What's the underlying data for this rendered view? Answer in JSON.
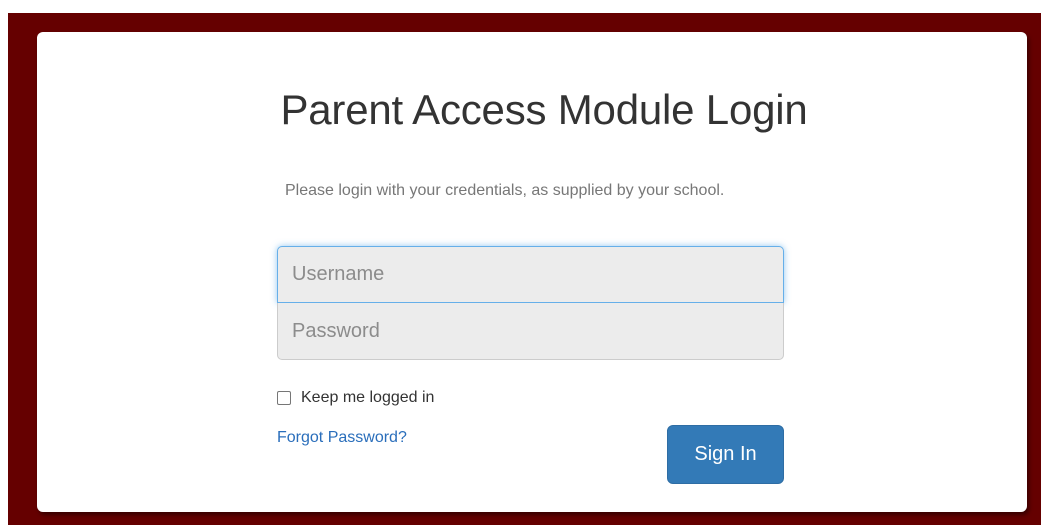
{
  "page": {
    "title": "Parent Access Module Login",
    "intro": "Please login with your credentials, as supplied by your school."
  },
  "form": {
    "username_placeholder": "Username",
    "username_value": "",
    "password_placeholder": "Password",
    "password_value": "",
    "remember_label": "Keep me logged in",
    "remember_checked": false,
    "forgot_label": "Forgot Password?",
    "signin_label": "Sign In"
  },
  "colors": {
    "frame": "#650000",
    "card": "#ffffff",
    "primary_button": "#337ab7",
    "link": "#2a6ebb",
    "focus_ring": "#66afe9"
  }
}
